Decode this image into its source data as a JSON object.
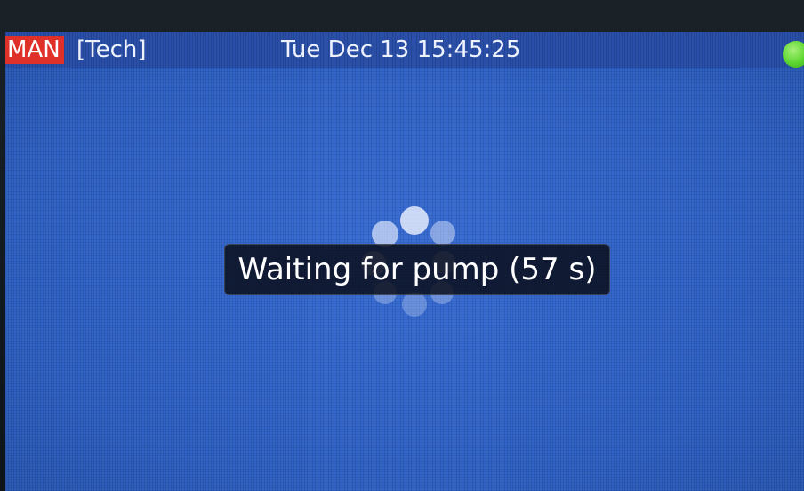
{
  "statusbar": {
    "mode": "MAN",
    "role": "[Tech]",
    "datetime": "Tue Dec 13 15:45:25",
    "indicator_icon": "status-led-green",
    "colors": {
      "mode_badge": "#e0302a",
      "indicator": "#5cd630",
      "screen_background": "#3566cc"
    }
  },
  "dialog": {
    "message": "Waiting for pump (57 s)",
    "spinner_icon": "loading-spinner-icon"
  }
}
